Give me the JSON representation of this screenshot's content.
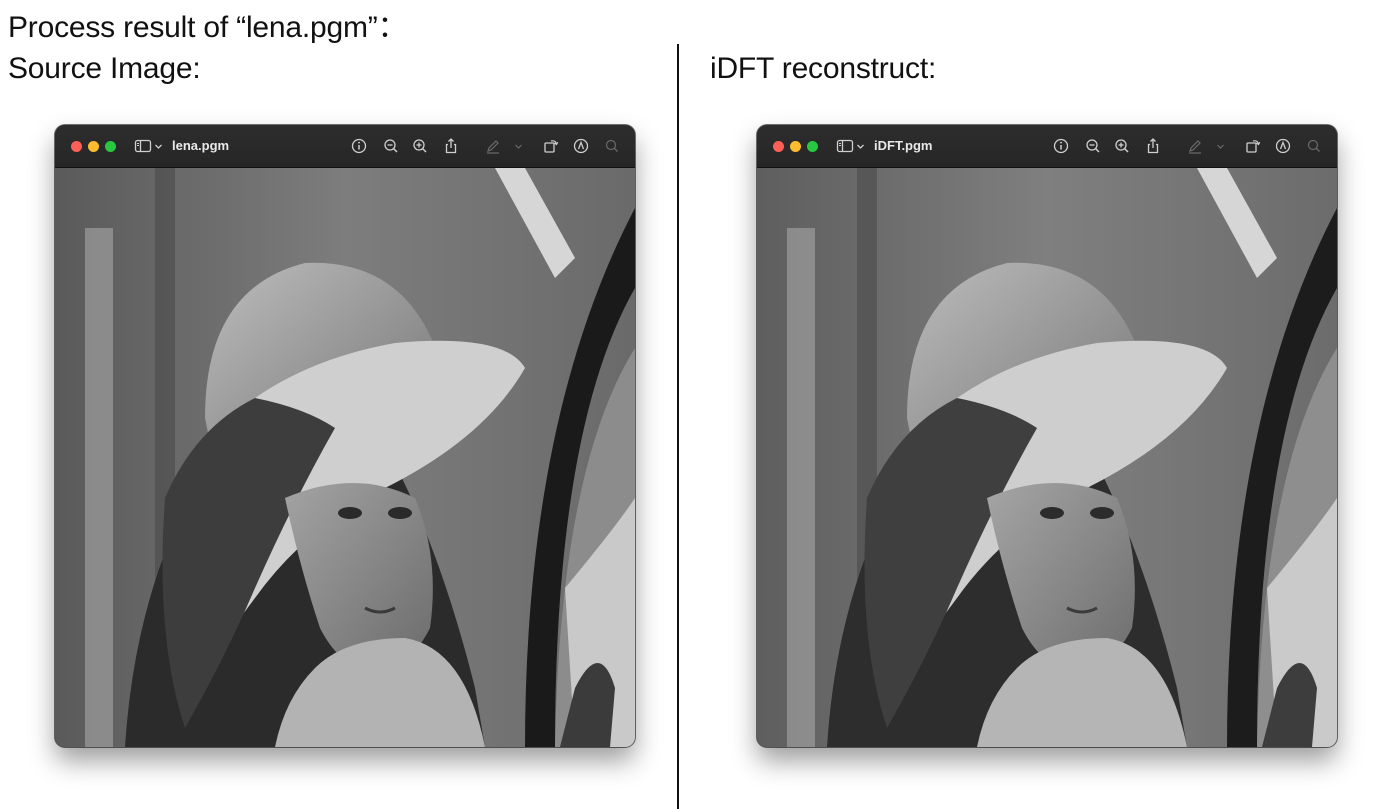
{
  "page": {
    "heading": "Process result of “lena.pgm”："
  },
  "panels": [
    {
      "label": "Source Image:",
      "window": {
        "filename": "lena.pgm"
      }
    },
    {
      "label": "iDFT reconstruct:",
      "window": {
        "filename": "iDFT.pgm"
      }
    }
  ],
  "icons": {
    "traffic_lights": [
      "close-button",
      "minimize-button",
      "zoom-button"
    ],
    "toolbar": [
      "sidebar-toggle-icon",
      "chevron-down-icon",
      "info-icon",
      "zoom-out-icon",
      "zoom-in-icon",
      "share-icon",
      "markup-pen-icon",
      "rotate-icon",
      "markup-circle-icon",
      "search-icon"
    ]
  },
  "colors": {
    "titlebar": "#2a2a2a",
    "close": "#fe5f57",
    "minimize": "#febc2e",
    "zoom": "#28c840",
    "toolbar_icon": "#cfcfcf",
    "toolbar_icon_disabled": "#6a6a6a"
  }
}
